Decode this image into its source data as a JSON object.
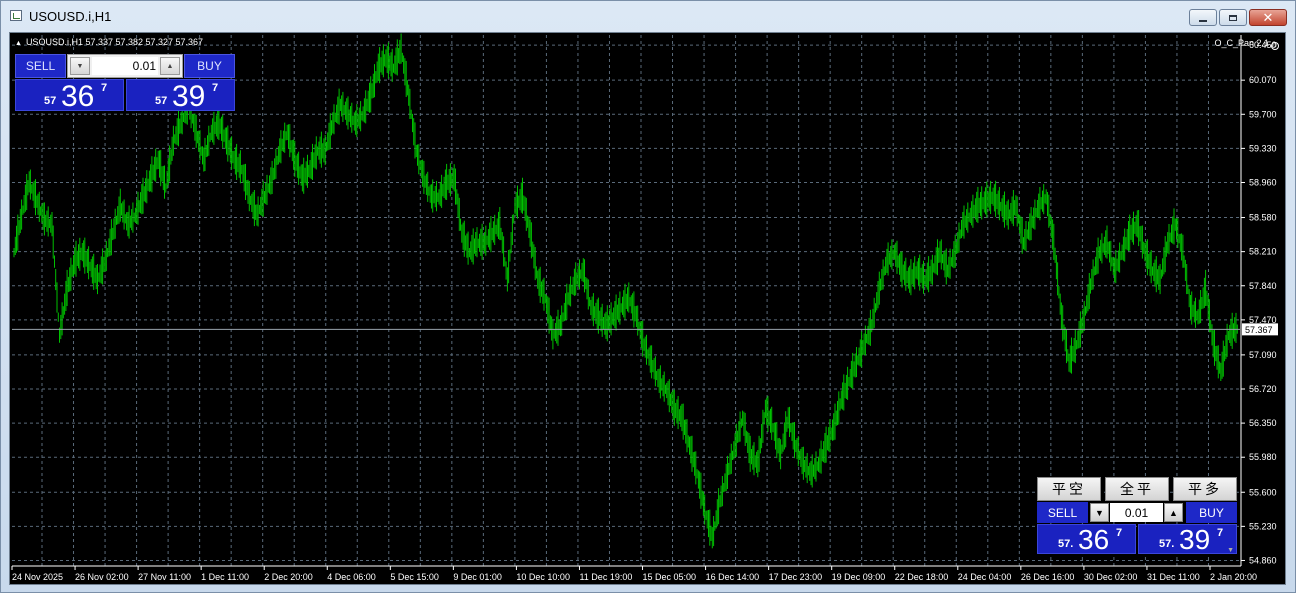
{
  "window": {
    "title": "USOUSD.i,H1"
  },
  "chart_header": {
    "text": "USOUSD.i,H1  57.337 57.382 57.327 57.367"
  },
  "indicator": {
    "name": "O_C_Pan 2.1"
  },
  "trade_panel": {
    "sell_label": "SELL",
    "buy_label": "BUY",
    "lot": "0.01",
    "bid_prefix": "57",
    "bid_main": "36",
    "bid_sup": "7",
    "ask_prefix": "57",
    "ask_main": "39",
    "ask_sup": "7"
  },
  "oc_panel": {
    "close_short": "平空",
    "close_all": "全平",
    "close_long": "平多",
    "sell_label": "SELL",
    "buy_label": "BUY",
    "lot": "0.01",
    "bid_prefix": "57.",
    "bid_main": "36",
    "bid_sup": "7",
    "ask_prefix": "57.",
    "ask_main": "39",
    "ask_sup": "7"
  },
  "colors": {
    "background": "#000000",
    "candle": "#00c000",
    "grid": "#5a6a7a",
    "text": "#ffffff",
    "panel_blue": "#1a22c0"
  },
  "chart_data": {
    "type": "line",
    "x_tick_labels": [
      "24 Nov 2025",
      "26 Nov 02:00",
      "27 Nov 11:00",
      "1 Dec 11:00",
      "2 Dec 20:00",
      "4 Dec 06:00",
      "5 Dec 15:00",
      "9 Dec 01:00",
      "10 Dec 10:00",
      "11 Dec 19:00",
      "15 Dec 05:00",
      "16 Dec 14:00",
      "17 Dec 23:00",
      "19 Dec 09:00",
      "22 Dec 18:00",
      "24 Dec 04:00",
      "26 Dec 16:00",
      "30 Dec 02:00",
      "31 Dec 11:00",
      "2 Jan 20:00"
    ],
    "y_tick_labels": [
      "60.450",
      "60.070",
      "59.700",
      "59.330",
      "58.960",
      "58.580",
      "58.210",
      "57.840",
      "57.470",
      "57.090",
      "56.720",
      "56.350",
      "55.980",
      "55.600",
      "55.230",
      "54.860"
    ],
    "y_ticks": [
      60.45,
      60.07,
      59.7,
      59.33,
      58.96,
      58.58,
      58.21,
      57.84,
      57.47,
      57.09,
      56.72,
      56.35,
      55.98,
      55.6,
      55.23,
      54.86
    ],
    "ylim": [
      54.8,
      60.56
    ],
    "current_price": 57.367,
    "current_price_label": "57.367",
    "grid": true,
    "series": [
      {
        "values": [
          58.2,
          58.6,
          58.96,
          58.75,
          58.55,
          58.5,
          57.3,
          57.8,
          58.1,
          58.2,
          58.05,
          57.9,
          58.1,
          58.4,
          58.7,
          58.5,
          58.6,
          58.8,
          59.0,
          59.2,
          58.9,
          59.4,
          59.6,
          59.8,
          59.5,
          59.2,
          59.5,
          59.6,
          59.4,
          59.2,
          59.1,
          58.8,
          58.6,
          58.8,
          59.0,
          59.3,
          59.5,
          59.2,
          59.0,
          59.1,
          59.3,
          59.3,
          59.6,
          59.8,
          59.7,
          59.6,
          59.7,
          59.9,
          60.2,
          60.3,
          60.2,
          60.4,
          59.9,
          59.3,
          59.0,
          58.8,
          58.8,
          58.95,
          59.0,
          58.4,
          58.2,
          58.3,
          58.3,
          58.4,
          58.5,
          57.9,
          58.7,
          58.8,
          58.4,
          57.9,
          57.7,
          57.3,
          57.4,
          57.7,
          57.9,
          58.0,
          57.6,
          57.5,
          57.4,
          57.5,
          57.6,
          57.7,
          57.5,
          57.2,
          57.0,
          56.8,
          56.7,
          56.5,
          56.4,
          56.1,
          55.8,
          55.4,
          55.1,
          55.5,
          55.8,
          56.1,
          56.4,
          56.0,
          55.9,
          56.5,
          56.3,
          56.0,
          56.4,
          56.1,
          55.9,
          55.8,
          55.9,
          56.1,
          56.3,
          56.6,
          56.8,
          57.0,
          57.2,
          57.4,
          57.8,
          58.1,
          58.2,
          58.0,
          57.9,
          58.0,
          57.9,
          58.0,
          58.2,
          58.0,
          58.2,
          58.5,
          58.6,
          58.7,
          58.75,
          58.8,
          58.7,
          58.6,
          58.7,
          58.3,
          58.5,
          58.7,
          58.8,
          58.3,
          57.5,
          57.0,
          57.2,
          57.5,
          57.9,
          58.2,
          58.3,
          58.0,
          58.2,
          58.4,
          58.5,
          58.2,
          58.0,
          57.9,
          58.3,
          58.5,
          58.2,
          57.6,
          57.5,
          57.8,
          57.2,
          56.9,
          57.3,
          57.37
        ]
      }
    ]
  }
}
